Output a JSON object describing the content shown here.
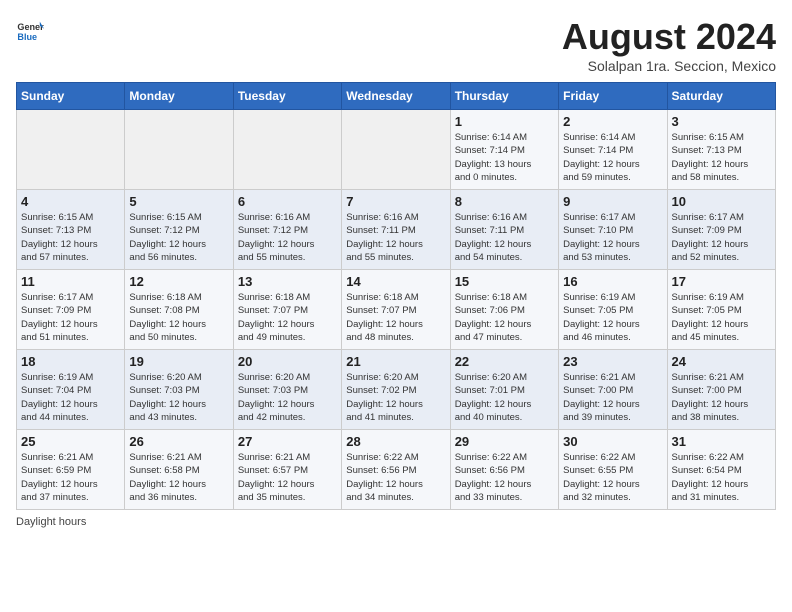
{
  "header": {
    "logo_general": "General",
    "logo_blue": "Blue",
    "title": "August 2024",
    "subtitle": "Solalpan 1ra. Seccion, Mexico"
  },
  "weekdays": [
    "Sunday",
    "Monday",
    "Tuesday",
    "Wednesday",
    "Thursday",
    "Friday",
    "Saturday"
  ],
  "footer": "Daylight hours",
  "weeks": [
    [
      {
        "day": "",
        "info": ""
      },
      {
        "day": "",
        "info": ""
      },
      {
        "day": "",
        "info": ""
      },
      {
        "day": "",
        "info": ""
      },
      {
        "day": "1",
        "info": "Sunrise: 6:14 AM\nSunset: 7:14 PM\nDaylight: 13 hours\nand 0 minutes."
      },
      {
        "day": "2",
        "info": "Sunrise: 6:14 AM\nSunset: 7:14 PM\nDaylight: 12 hours\nand 59 minutes."
      },
      {
        "day": "3",
        "info": "Sunrise: 6:15 AM\nSunset: 7:13 PM\nDaylight: 12 hours\nand 58 minutes."
      }
    ],
    [
      {
        "day": "4",
        "info": "Sunrise: 6:15 AM\nSunset: 7:13 PM\nDaylight: 12 hours\nand 57 minutes."
      },
      {
        "day": "5",
        "info": "Sunrise: 6:15 AM\nSunset: 7:12 PM\nDaylight: 12 hours\nand 56 minutes."
      },
      {
        "day": "6",
        "info": "Sunrise: 6:16 AM\nSunset: 7:12 PM\nDaylight: 12 hours\nand 55 minutes."
      },
      {
        "day": "7",
        "info": "Sunrise: 6:16 AM\nSunset: 7:11 PM\nDaylight: 12 hours\nand 55 minutes."
      },
      {
        "day": "8",
        "info": "Sunrise: 6:16 AM\nSunset: 7:11 PM\nDaylight: 12 hours\nand 54 minutes."
      },
      {
        "day": "9",
        "info": "Sunrise: 6:17 AM\nSunset: 7:10 PM\nDaylight: 12 hours\nand 53 minutes."
      },
      {
        "day": "10",
        "info": "Sunrise: 6:17 AM\nSunset: 7:09 PM\nDaylight: 12 hours\nand 52 minutes."
      }
    ],
    [
      {
        "day": "11",
        "info": "Sunrise: 6:17 AM\nSunset: 7:09 PM\nDaylight: 12 hours\nand 51 minutes."
      },
      {
        "day": "12",
        "info": "Sunrise: 6:18 AM\nSunset: 7:08 PM\nDaylight: 12 hours\nand 50 minutes."
      },
      {
        "day": "13",
        "info": "Sunrise: 6:18 AM\nSunset: 7:07 PM\nDaylight: 12 hours\nand 49 minutes."
      },
      {
        "day": "14",
        "info": "Sunrise: 6:18 AM\nSunset: 7:07 PM\nDaylight: 12 hours\nand 48 minutes."
      },
      {
        "day": "15",
        "info": "Sunrise: 6:18 AM\nSunset: 7:06 PM\nDaylight: 12 hours\nand 47 minutes."
      },
      {
        "day": "16",
        "info": "Sunrise: 6:19 AM\nSunset: 7:05 PM\nDaylight: 12 hours\nand 46 minutes."
      },
      {
        "day": "17",
        "info": "Sunrise: 6:19 AM\nSunset: 7:05 PM\nDaylight: 12 hours\nand 45 minutes."
      }
    ],
    [
      {
        "day": "18",
        "info": "Sunrise: 6:19 AM\nSunset: 7:04 PM\nDaylight: 12 hours\nand 44 minutes."
      },
      {
        "day": "19",
        "info": "Sunrise: 6:20 AM\nSunset: 7:03 PM\nDaylight: 12 hours\nand 43 minutes."
      },
      {
        "day": "20",
        "info": "Sunrise: 6:20 AM\nSunset: 7:03 PM\nDaylight: 12 hours\nand 42 minutes."
      },
      {
        "day": "21",
        "info": "Sunrise: 6:20 AM\nSunset: 7:02 PM\nDaylight: 12 hours\nand 41 minutes."
      },
      {
        "day": "22",
        "info": "Sunrise: 6:20 AM\nSunset: 7:01 PM\nDaylight: 12 hours\nand 40 minutes."
      },
      {
        "day": "23",
        "info": "Sunrise: 6:21 AM\nSunset: 7:00 PM\nDaylight: 12 hours\nand 39 minutes."
      },
      {
        "day": "24",
        "info": "Sunrise: 6:21 AM\nSunset: 7:00 PM\nDaylight: 12 hours\nand 38 minutes."
      }
    ],
    [
      {
        "day": "25",
        "info": "Sunrise: 6:21 AM\nSunset: 6:59 PM\nDaylight: 12 hours\nand 37 minutes."
      },
      {
        "day": "26",
        "info": "Sunrise: 6:21 AM\nSunset: 6:58 PM\nDaylight: 12 hours\nand 36 minutes."
      },
      {
        "day": "27",
        "info": "Sunrise: 6:21 AM\nSunset: 6:57 PM\nDaylight: 12 hours\nand 35 minutes."
      },
      {
        "day": "28",
        "info": "Sunrise: 6:22 AM\nSunset: 6:56 PM\nDaylight: 12 hours\nand 34 minutes."
      },
      {
        "day": "29",
        "info": "Sunrise: 6:22 AM\nSunset: 6:56 PM\nDaylight: 12 hours\nand 33 minutes."
      },
      {
        "day": "30",
        "info": "Sunrise: 6:22 AM\nSunset: 6:55 PM\nDaylight: 12 hours\nand 32 minutes."
      },
      {
        "day": "31",
        "info": "Sunrise: 6:22 AM\nSunset: 6:54 PM\nDaylight: 12 hours\nand 31 minutes."
      }
    ]
  ]
}
